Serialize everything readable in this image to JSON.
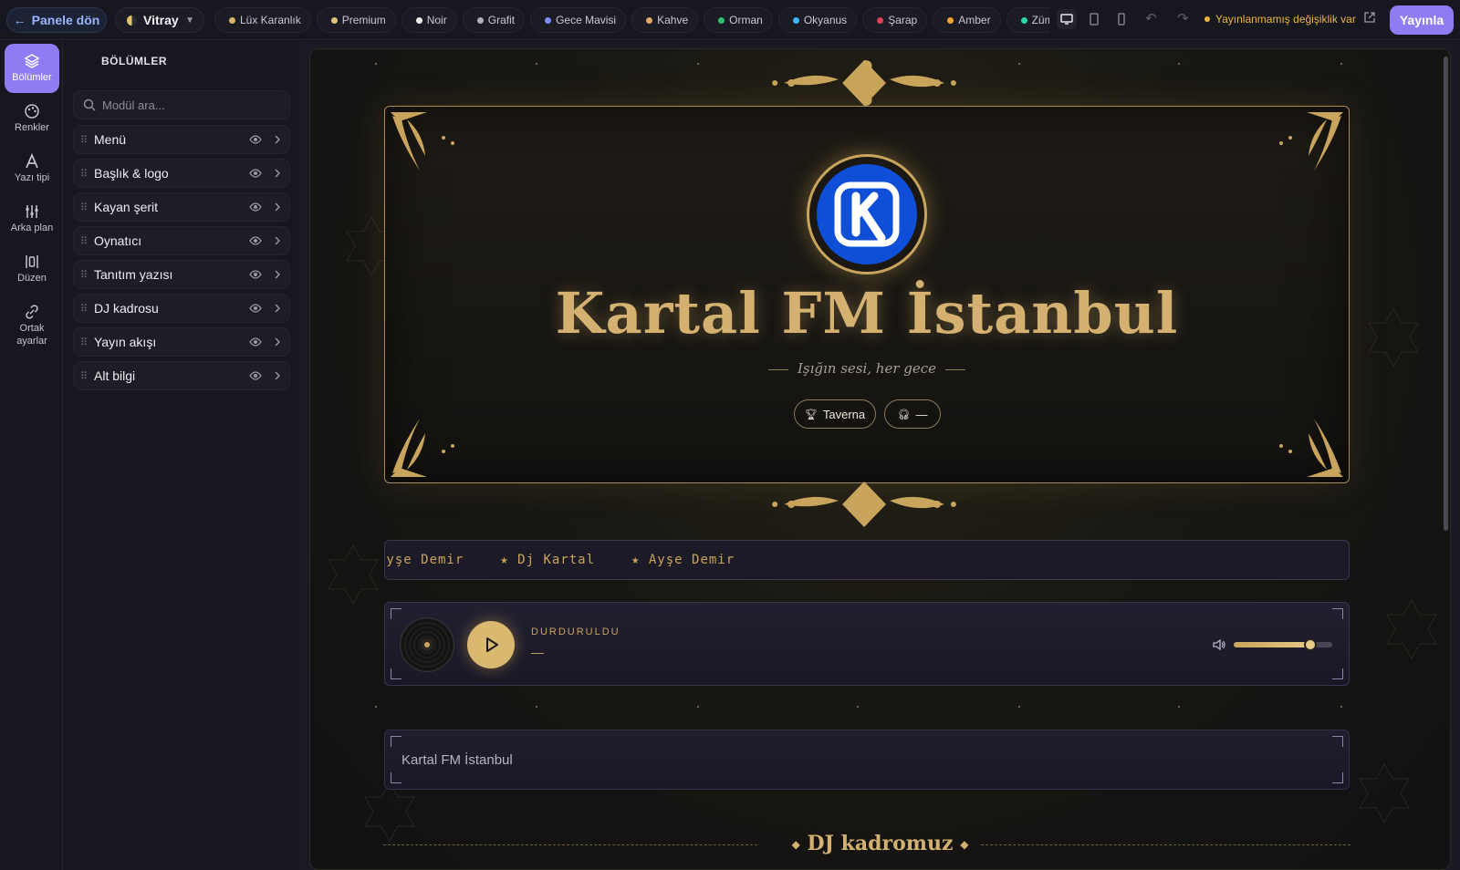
{
  "topbar": {
    "back_label": "Panele dön",
    "theme_name": "Vitray",
    "presets": [
      {
        "label": "Lüx Karanlık",
        "color": "#d8b46a"
      },
      {
        "label": "Premium",
        "color": "#e0c27d"
      },
      {
        "label": "Noir",
        "color": "#f0f0f0"
      },
      {
        "label": "Grafit",
        "color": "#b0b0b8"
      },
      {
        "label": "Gece Mavisi",
        "color": "#7f8cff"
      },
      {
        "label": "Kahve",
        "color": "#e2a86a"
      },
      {
        "label": "Orman",
        "color": "#2fbf71"
      },
      {
        "label": "Okyanus",
        "color": "#3db7ff"
      },
      {
        "label": "Şarap",
        "color": "#e0405a"
      },
      {
        "label": "Amber",
        "color": "#f2a33a"
      },
      {
        "label": "Zümrüt",
        "color": "#2dd4a4"
      }
    ],
    "unsaved_text": "Yayınlanmamış değişiklik var",
    "publish_label": "Yayınla"
  },
  "rail": [
    {
      "label": "Bölümler",
      "icon": "layers-icon",
      "active": true
    },
    {
      "label": "Renkler",
      "icon": "palette-icon"
    },
    {
      "label": "Yazı tipi",
      "icon": "font-icon"
    },
    {
      "label": "Arka plan",
      "icon": "sliders-icon"
    },
    {
      "label": "Düzen",
      "icon": "layout-icon"
    },
    {
      "label": "Ortak ayarlar",
      "icon": "link-icon"
    }
  ],
  "panel": {
    "title": "BÖLÜMLER",
    "search_placeholder": "Modül ara...",
    "sections": [
      {
        "label": "Menü"
      },
      {
        "label": "Başlık & logo"
      },
      {
        "label": "Kayan şerit"
      },
      {
        "label": "Oynatıcı"
      },
      {
        "label": "Tanıtım yazısı"
      },
      {
        "label": "DJ kadrosu"
      },
      {
        "label": "Yayın akışı"
      },
      {
        "label": "Alt bilgi"
      }
    ]
  },
  "preview": {
    "site_title": "Kartal FM İstanbul",
    "tagline": "Işığın sesi, her gece",
    "chip_1": "Taverna",
    "chip_2": "—",
    "ticker_items": [
      "Ayşe Demir",
      "★ Dj Kartal",
      "★ Ayşe Demir"
    ],
    "player_status": "DURDURULDU",
    "now_playing": "—",
    "volume_fraction": 0.78,
    "intro_text": "Kartal FM İstanbul",
    "dj_heading": "DJ kadromuz",
    "accent_color": "#c9a45c"
  }
}
